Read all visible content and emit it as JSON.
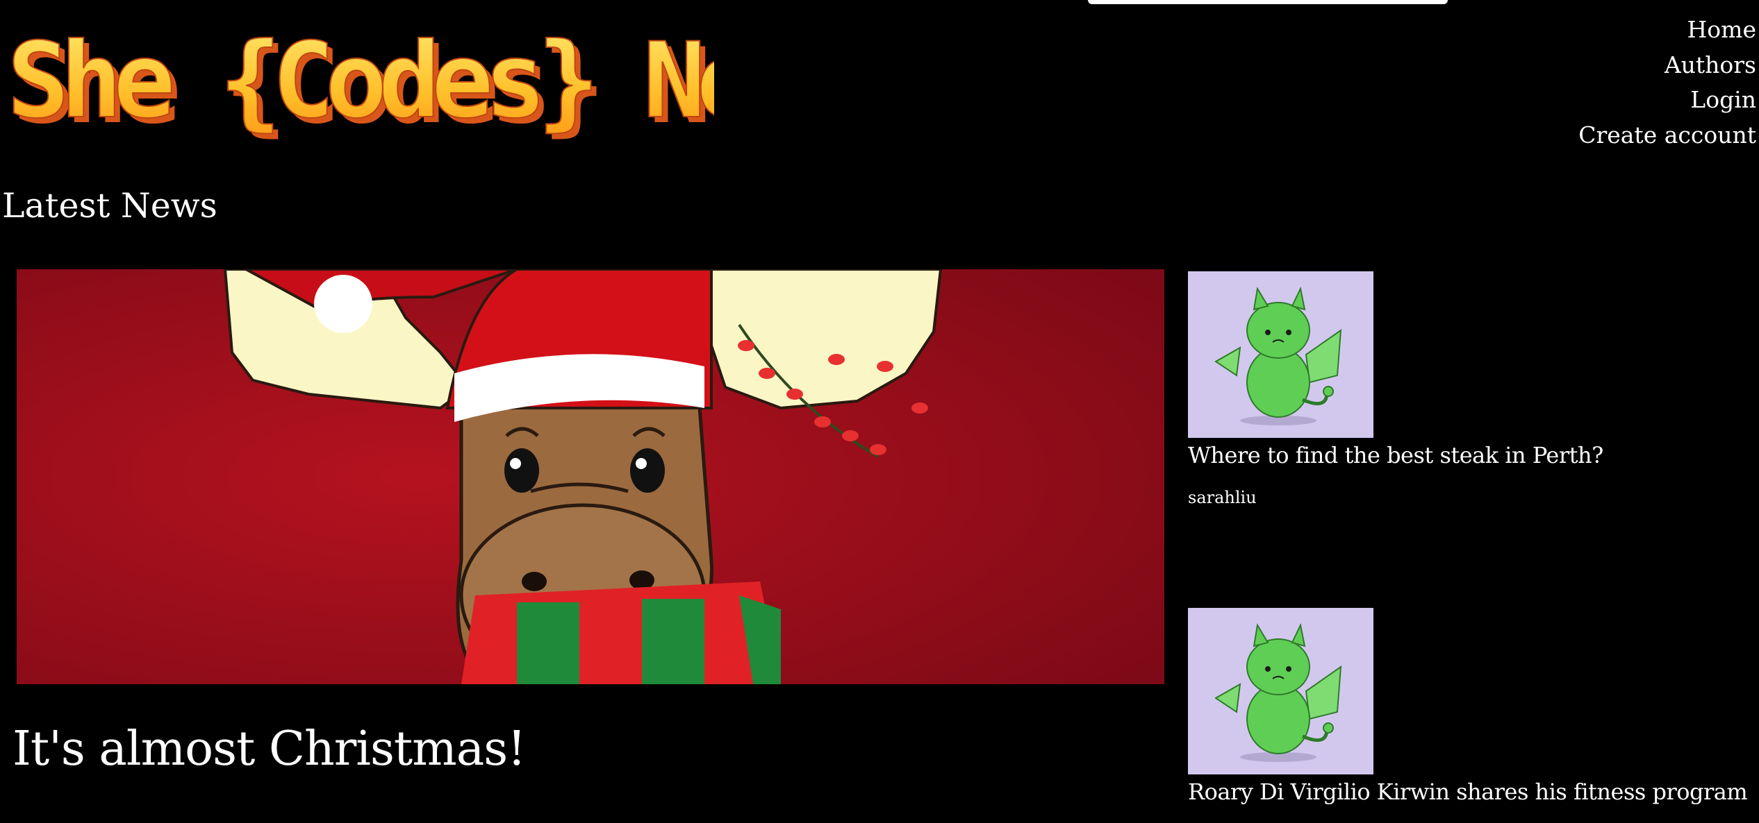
{
  "header": {
    "logo_text": "She {Codes} News",
    "nav": [
      {
        "label": "Home"
      },
      {
        "label": "Authors"
      },
      {
        "label": "Login"
      },
      {
        "label": "Create account"
      }
    ]
  },
  "main": {
    "section_title": "Latest News",
    "featured": {
      "title": "It's almost Christmas!",
      "image_icon": "christmas-moose-illustration"
    },
    "stories": [
      {
        "title": "Where to find the best steak in Perth?",
        "author": "sarahliu",
        "image_icon": "green-dragon-illustration"
      },
      {
        "title": "Roary Di Virgilio Kirwin shares his fitness program",
        "image_icon": "green-dragon-illustration"
      }
    ]
  },
  "colors": {
    "background": "#000000",
    "text": "#ffffff",
    "logo_face": "#ffc43a",
    "logo_side": "#e8671a",
    "featured_bg": "#a8101e",
    "thumb_bg": "#d2c8ee",
    "dragon": "#5fce55"
  }
}
